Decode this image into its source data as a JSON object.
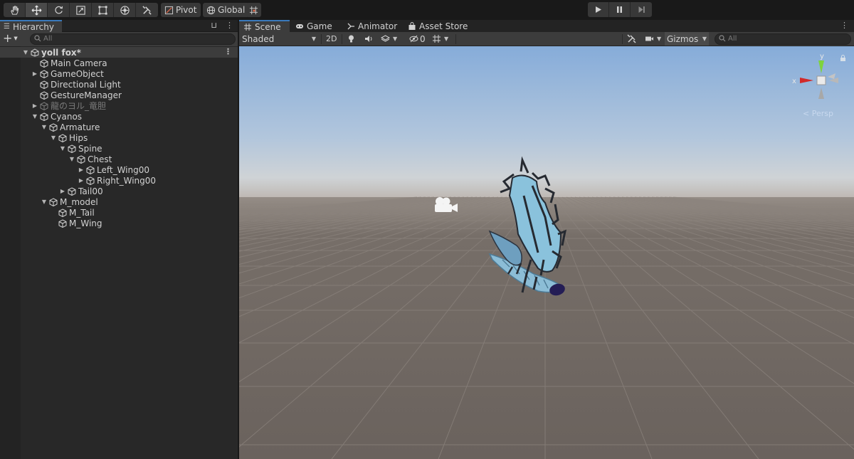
{
  "toolbar": {
    "tools": [
      "hand-icon",
      "move-icon",
      "rotate-icon",
      "scale-icon",
      "rect-icon",
      "transform-icon",
      "custom-tool-icon"
    ],
    "pivot_label": "Pivot",
    "global_label": "Global",
    "grid_snap_icon": "grid-snap-icon",
    "playback": [
      "play-icon",
      "pause-icon",
      "step-icon"
    ]
  },
  "hierarchy": {
    "tab_label": "Hierarchy",
    "add_label": "+",
    "search_placeholder": "All",
    "scene_name": "yoll fox*",
    "items": [
      {
        "label": "Main Camera",
        "depth": 0,
        "expand": "none",
        "disabled": false
      },
      {
        "label": "GameObject",
        "depth": 0,
        "expand": "collapsed",
        "disabled": false
      },
      {
        "label": "Directional Light",
        "depth": 0,
        "expand": "none",
        "disabled": false
      },
      {
        "label": "GestureManager",
        "depth": 0,
        "expand": "none",
        "disabled": false
      },
      {
        "label": "龍のヨル_竜胆",
        "depth": 0,
        "expand": "collapsed",
        "disabled": true
      },
      {
        "label": "Cyanos",
        "depth": 0,
        "expand": "expanded",
        "disabled": false
      },
      {
        "label": "Armature",
        "depth": 1,
        "expand": "expanded",
        "disabled": false
      },
      {
        "label": "Hips",
        "depth": 2,
        "expand": "expanded",
        "disabled": false
      },
      {
        "label": "Spine",
        "depth": 3,
        "expand": "expanded",
        "disabled": false
      },
      {
        "label": "Chest",
        "depth": 4,
        "expand": "expanded",
        "disabled": false
      },
      {
        "label": "Left_Wing00",
        "depth": 5,
        "expand": "collapsed",
        "disabled": false
      },
      {
        "label": "Right_Wing00",
        "depth": 5,
        "expand": "collapsed",
        "disabled": false
      },
      {
        "label": "Tail00",
        "depth": 3,
        "expand": "collapsed",
        "disabled": false
      },
      {
        "label": "M_model",
        "depth": 1,
        "expand": "expanded",
        "disabled": false
      },
      {
        "label": "M_Tail",
        "depth": 2,
        "expand": "none",
        "disabled": false
      },
      {
        "label": "M_Wing",
        "depth": 2,
        "expand": "none",
        "disabled": false
      }
    ]
  },
  "scene_panel": {
    "tabs": [
      {
        "label": "Scene",
        "icon": "grid-icon",
        "active": true
      },
      {
        "label": "Game",
        "icon": "gamepad-icon",
        "active": false
      },
      {
        "label": "Animator",
        "icon": "animator-icon",
        "active": false
      },
      {
        "label": "Asset Store",
        "icon": "bag-icon",
        "active": false
      }
    ],
    "shading_mode": "Shaded",
    "mode_2d_label": "2D",
    "hidden_count": "0",
    "gizmos_label": "Gizmos",
    "search_placeholder": "All",
    "axis_x_label": "x",
    "axis_y_label": "y",
    "projection_label": "Persp"
  },
  "colors": {
    "accent": "#3a79bb",
    "sky_top": "#8cb1dd",
    "ground": "#6e6661",
    "model_body": "#7fb4cf",
    "model_dark": "#2a2f3a"
  }
}
